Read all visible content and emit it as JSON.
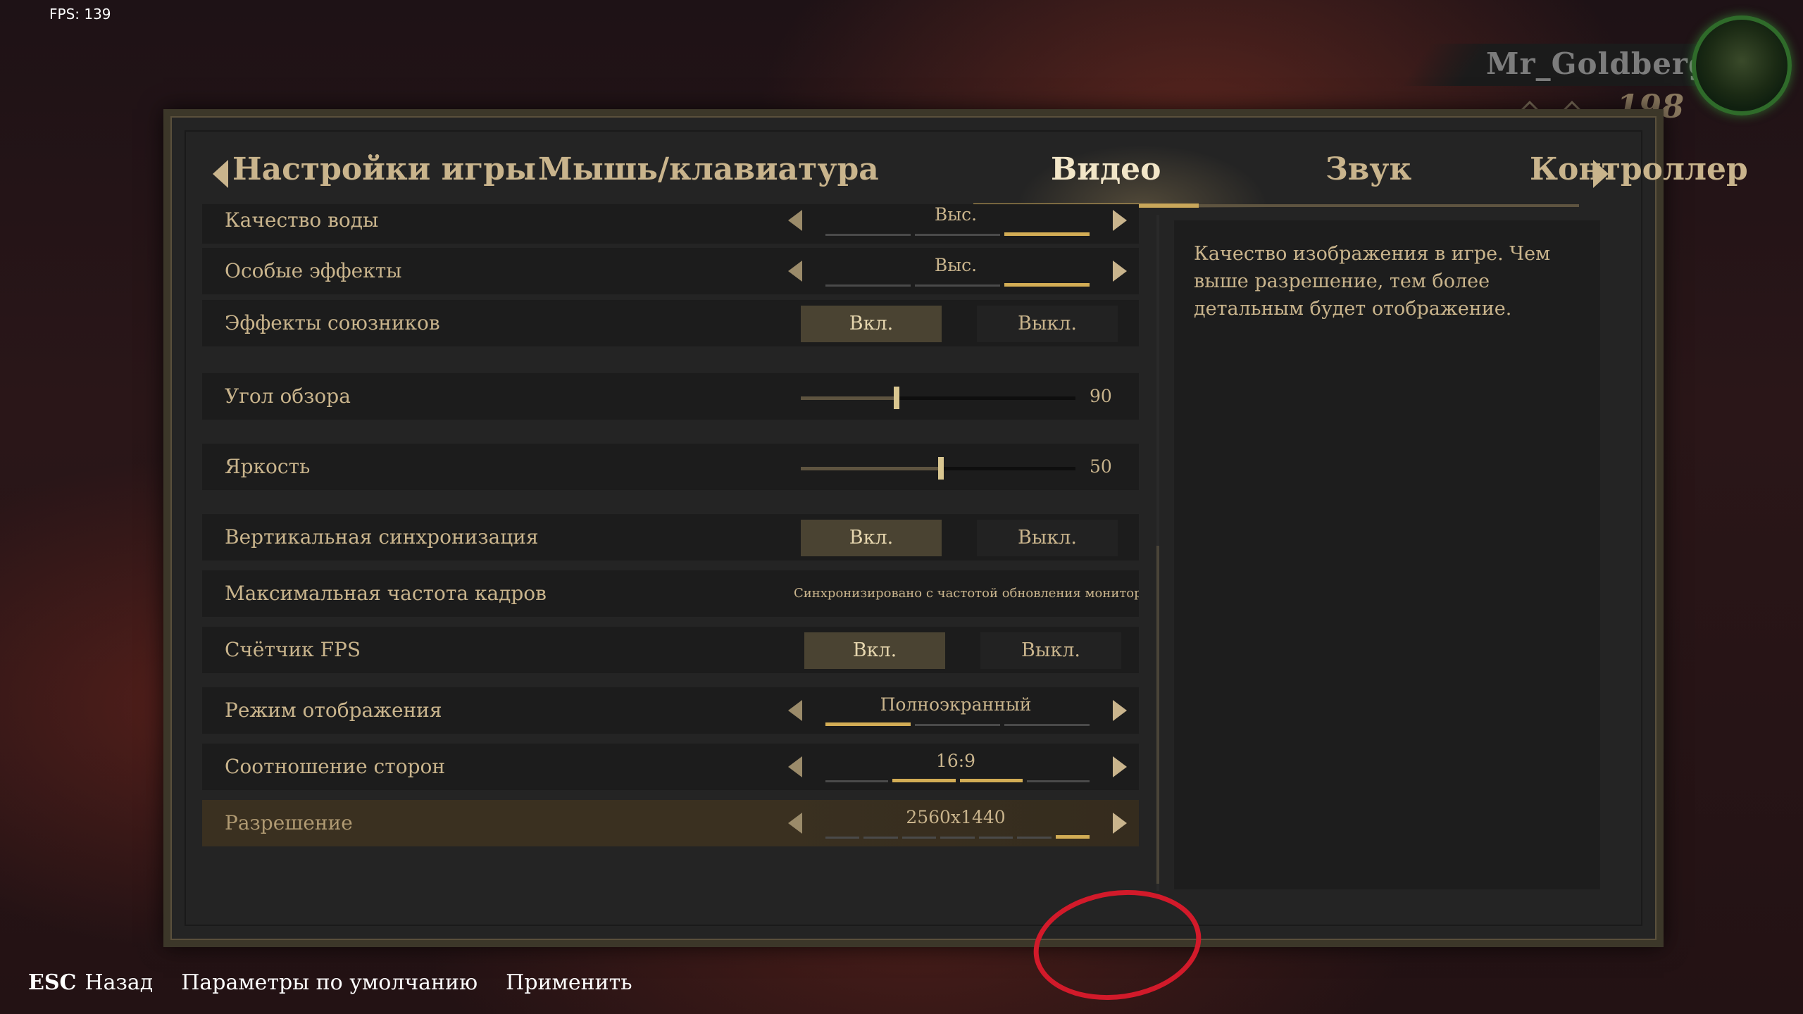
{
  "hud": {
    "fps": "FPS: 139"
  },
  "player": {
    "name": "Mr_Goldberg",
    "level": "198",
    "avatar_icon": "player-avatar"
  },
  "tabs": [
    {
      "label": "Настройки игры"
    },
    {
      "label": "Мышь/клавиатура"
    },
    {
      "label": "Видео",
      "active": true
    },
    {
      "label": "Звук"
    },
    {
      "label": "Контроллер"
    }
  ],
  "settings": {
    "water_quality": {
      "label": "Качество воды",
      "value": "Выс."
    },
    "special_effects": {
      "label": "Особые эффекты",
      "value": "Выс."
    },
    "ally_effects": {
      "label": "Эффекты союзников",
      "on": "Вкл.",
      "off": "Выкл."
    },
    "fov": {
      "label": "Угол обзора",
      "value": "90",
      "fraction": 0.35
    },
    "brightness": {
      "label": "Яркость",
      "value": "50",
      "fraction": 0.5
    },
    "vsync": {
      "label": "Вертикальная синхронизация",
      "on": "Вкл.",
      "off": "Выкл."
    },
    "max_fps": {
      "label": "Максимальная частота кадров",
      "value": "Синхронизировано с частотой обновления монитора"
    },
    "fps_counter": {
      "label": "Счётчик FPS",
      "on": "Вкл.",
      "off": "Выкл."
    },
    "display_mode": {
      "label": "Режим отображения",
      "value": "Полноэкранный"
    },
    "aspect_ratio": {
      "label": "Соотношение сторон",
      "value": "16:9"
    },
    "resolution": {
      "label": "Разрешение",
      "value": "2560x1440"
    }
  },
  "description": "Качество изображения в игре. Чем выше разрешение, тем более детальным будет отображение.",
  "footer": {
    "esc_key": "ESC",
    "back": "Назад",
    "defaults": "Параметры по умолчанию",
    "apply": "Применить"
  },
  "colors": {
    "accent": "#d3ad55",
    "annotation": "#d21a2a"
  }
}
